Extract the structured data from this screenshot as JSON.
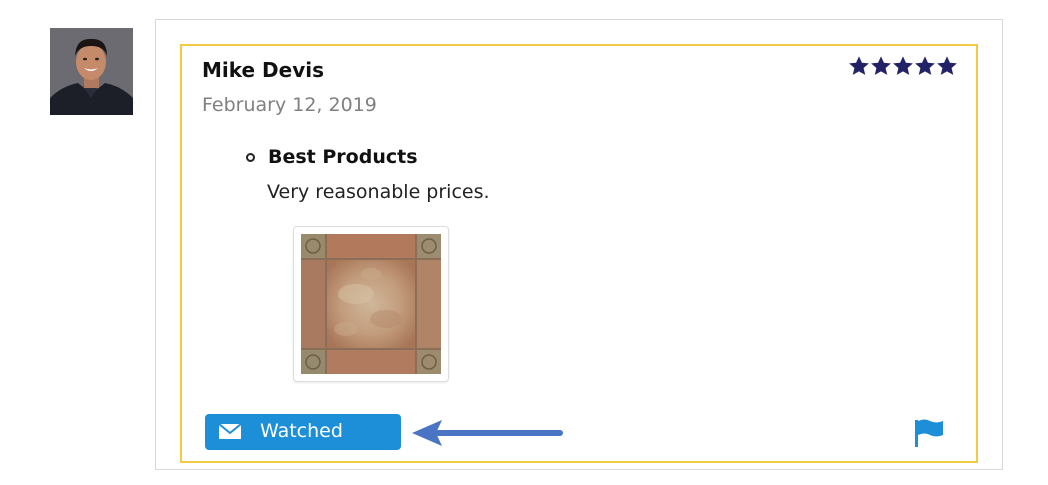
{
  "review": {
    "reviewer_name": "Mike Devis",
    "date": "February 12, 2019",
    "rating": 5,
    "rating_max": 5,
    "title": "Best Products",
    "body": "Very reasonable prices.",
    "watch_button_label": "Watched"
  },
  "icons": {
    "avatar": "avatar-photo",
    "star": "star-icon",
    "bullet": "hollow-circle-bullet",
    "mail": "envelope-icon",
    "flag": "flag-icon",
    "arrow": "left-arrow"
  },
  "colors": {
    "card_border": "#f2cb45",
    "star": "#222266",
    "button": "#1d8fd9",
    "flag": "#1d8fd9",
    "arrow": "#4a74c4",
    "date_text": "#808080"
  }
}
